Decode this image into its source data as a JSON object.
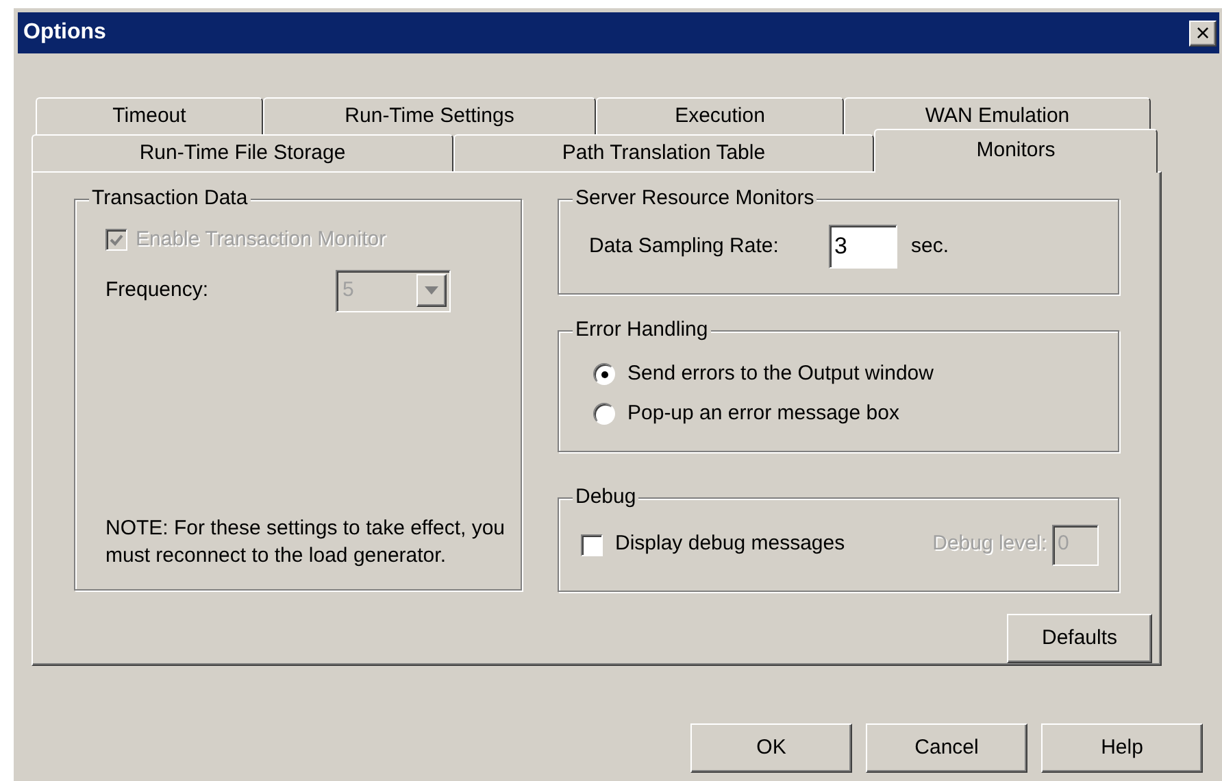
{
  "window": {
    "title": "Options",
    "close": "×"
  },
  "tab_rows": [
    [
      {
        "label": "Timeout",
        "selected": false
      },
      {
        "label": "Run-Time Settings",
        "selected": false
      },
      {
        "label": "Execution",
        "selected": false
      },
      {
        "label": "WAN Emulation",
        "selected": false
      }
    ],
    [
      {
        "label": "Run-Time File Storage",
        "selected": false
      },
      {
        "label": "Path Translation Table",
        "selected": false
      },
      {
        "label": "Monitors",
        "selected": true
      }
    ]
  ],
  "transaction_data": {
    "title": "Transaction Data",
    "enable": {
      "label": "Enable Transaction Monitor",
      "checked": true,
      "disabled": true
    },
    "frequency": {
      "label": "Frequency:",
      "value": "5",
      "disabled": true
    },
    "note": "NOTE: For these settings to take effect, you must reconnect to the load generator."
  },
  "server_resource_monitors": {
    "title": "Server Resource Monitors",
    "label": "Data Sampling Rate:",
    "value": "3",
    "unit": "sec."
  },
  "error_handling": {
    "title": "Error Handling",
    "options": [
      {
        "label": "Send errors to the Output window",
        "selected": true
      },
      {
        "label": "Pop-up an error message box",
        "selected": false
      }
    ]
  },
  "debug": {
    "title": "Debug",
    "display": {
      "label": "Display debug messages",
      "checked": false
    },
    "level": {
      "label": "Debug level:",
      "value": "0",
      "disabled": true
    }
  },
  "defaults_button": "Defaults",
  "buttons": [
    "OK",
    "Cancel",
    "Help"
  ]
}
